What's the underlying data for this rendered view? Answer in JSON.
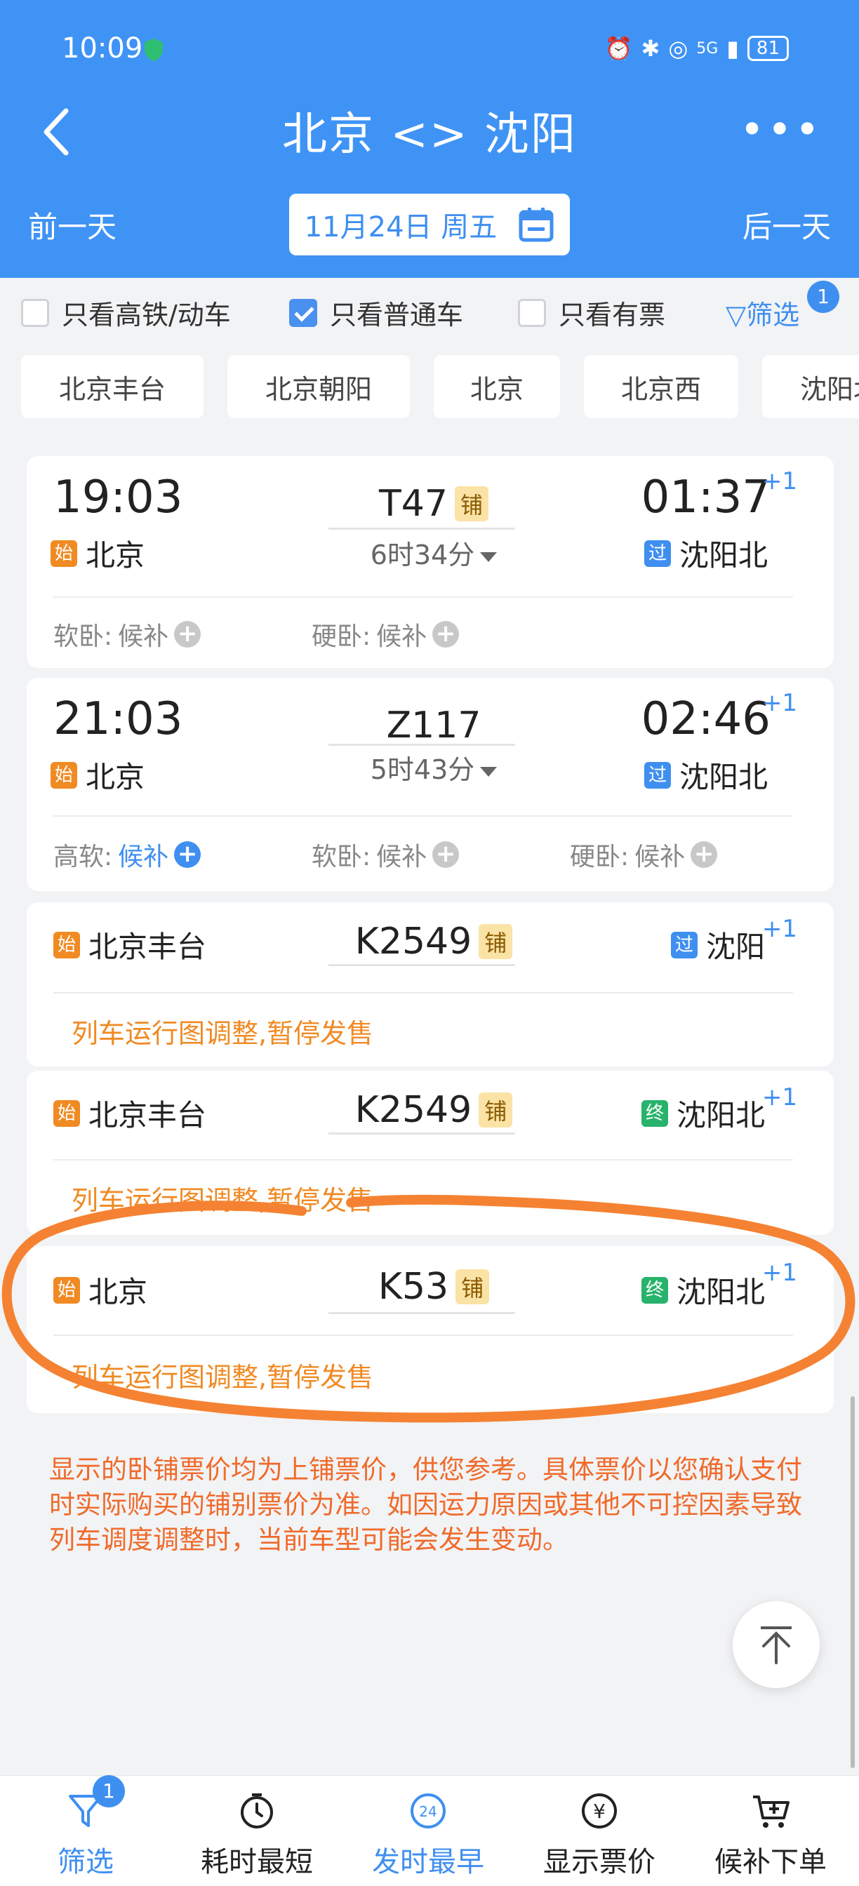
{
  "status_bar": {
    "time": "10:09",
    "network": "5G",
    "battery": "81"
  },
  "header": {
    "title": "北京 <> 沈阳",
    "prev_day": "前一天",
    "next_day": "后一天",
    "date": "11月24日 周五"
  },
  "filters": {
    "only_high_speed": {
      "label": "只看高铁/动车",
      "checked": false
    },
    "only_normal": {
      "label": "只看普通车",
      "checked": true
    },
    "only_available": {
      "label": "只看有票",
      "checked": false
    },
    "filter_label": "筛选",
    "filter_badge": "1"
  },
  "stations": [
    "北京丰台",
    "北京朝阳",
    "北京",
    "北京西",
    "沈阳北"
  ],
  "trains": [
    {
      "dep_time": "19:03",
      "arr_time": "01:37",
      "plus": "+1",
      "train_no": "T47",
      "tag": "铺",
      "duration": "6时34分",
      "from_tag": "始",
      "from": "北京",
      "to_tag": "过",
      "to": "沈阳北",
      "seats": [
        {
          "name": "软卧:",
          "value": "候补"
        },
        {
          "name": "硬卧:",
          "value": "候补"
        }
      ]
    },
    {
      "dep_time": "21:03",
      "arr_time": "02:46",
      "plus": "+1",
      "train_no": "Z117",
      "duration": "5时43分",
      "from_tag": "始",
      "from": "北京",
      "to_tag": "过",
      "to": "沈阳北",
      "seats": [
        {
          "name": "高软:",
          "value": "候补"
        },
        {
          "name": "软卧:",
          "value": "候补"
        },
        {
          "name": "硬卧:",
          "value": "候补"
        }
      ]
    },
    {
      "train_no": "K2549",
      "tag": "铺",
      "plus": "+1",
      "from_tag": "始",
      "from": "北京丰台",
      "to_tag": "过",
      "to": "沈阳",
      "status": "列车运行图调整,暂停发售"
    },
    {
      "train_no": "K2549",
      "tag": "铺",
      "plus": "+1",
      "from_tag": "始",
      "from": "北京丰台",
      "to_tag": "终",
      "to": "沈阳北",
      "status": "列车运行图调整,暂停发售"
    },
    {
      "train_no": "K53",
      "tag": "铺",
      "plus": "+1",
      "from_tag": "始",
      "from": "北京",
      "to_tag": "终",
      "to": "沈阳北",
      "status": "列车运行图调整,暂停发售"
    }
  ],
  "notice": "显示的卧铺票价均为上铺票价，供您参考。具体票价以您确认支付时实际购买的铺别票价为准。如因运力原因或其他不可控因素导致列车调度调整时，当前车型可能会发生变动。",
  "bottom_tabs": [
    {
      "label": "筛选",
      "icon": "filter-icon",
      "badge": "1"
    },
    {
      "label": "耗时最短",
      "icon": "timer-icon"
    },
    {
      "label": "发时最早",
      "icon": "clock-24-icon"
    },
    {
      "label": "显示票价",
      "icon": "yen-icon"
    },
    {
      "label": "候补下单",
      "icon": "cart-icon"
    }
  ],
  "colors": {
    "primary": "#3f93f5",
    "accent_orange": "#f08a23",
    "highlight_stroke": "#f58232"
  }
}
